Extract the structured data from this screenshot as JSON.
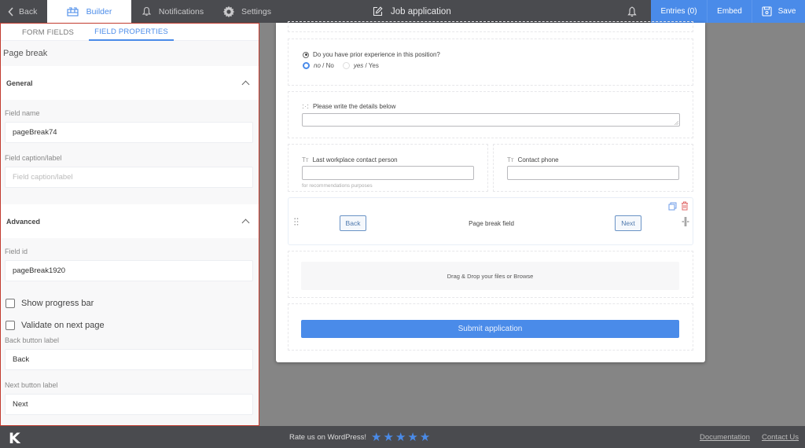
{
  "topbar": {
    "back_label": "Back",
    "builder_label": "Builder",
    "notifications_label": "Notifications",
    "settings_label": "Settings",
    "form_title": "Job application",
    "entries_label": "Entries (0)",
    "embed_label": "Embed",
    "save_label": "Save"
  },
  "left_panel": {
    "tabs": [
      {
        "label": "FORM FIELDS",
        "active": false
      },
      {
        "label": "FIELD PROPERTIES",
        "active": true
      }
    ],
    "heading": "Page break",
    "general": {
      "title": "General",
      "field_name_label": "Field name",
      "field_name_value": "pageBreak74",
      "caption_label": "Field caption/label",
      "caption_placeholder": "Field caption/label"
    },
    "advanced": {
      "title": "Advanced",
      "field_id_label": "Field id",
      "field_id_value": "pageBreak1920",
      "show_progress_label": "Show progress bar",
      "show_progress_checked": false,
      "validate_label": "Validate on next page",
      "validate_checked": false,
      "back_label_label": "Back button label",
      "back_label_value": "Back",
      "next_label_label": "Next button label",
      "next_label_value": "Next"
    }
  },
  "form": {
    "question": "Do you have prior experience in this position?",
    "options": [
      {
        "value": "no",
        "label": "No",
        "selected": true
      },
      {
        "value": "yes",
        "label": "Yes",
        "selected": false
      }
    ],
    "details_label": "Please write the details below",
    "contact_person_label": "Last workplace contact person",
    "contact_person_help": "for recommendations purposes",
    "contact_phone_label": "Contact phone",
    "page_break": {
      "back": "Back",
      "title": "Page break field",
      "next": "Next"
    },
    "dropzone_text": "Drag & Drop your files or Browse",
    "submit_label": "Submit application"
  },
  "footer": {
    "logo": "K",
    "rate_text": "Rate us on WordPress!",
    "stars": 5,
    "documentation": "Documentation",
    "contact": "Contact Us"
  },
  "colors": {
    "accent": "#4a8be9",
    "topbar": "#4a4b4f",
    "selection_border": "#c23b2f",
    "delete_icon": "#e06a6a"
  }
}
